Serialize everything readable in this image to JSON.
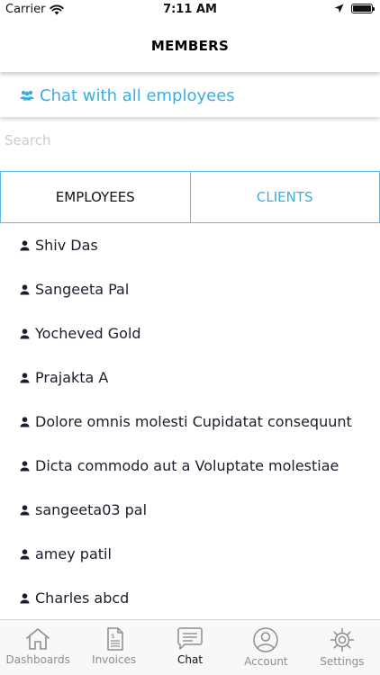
{
  "status_bar": {
    "carrier": "Carrier",
    "time": "7:11 AM"
  },
  "header": {
    "title": "MEMBERS"
  },
  "chat_all": {
    "label": "Chat with all employees",
    "icon": "group-icon",
    "color": "#3aaee0"
  },
  "search": {
    "placeholder": "Search",
    "value": ""
  },
  "tabs": [
    {
      "label": "EMPLOYEES",
      "selected": true
    },
    {
      "label": "CLIENTS",
      "selected": false
    }
  ],
  "members": [
    "Shiv Das",
    "Sangeeta Pal",
    "Yocheved Gold",
    "Prajakta A",
    "Dolore omnis molesti Cupidatat consequunt",
    "Dicta commodo aut a Voluptate molestiae",
    "sangeeta03 pal",
    "amey patil",
    "Charles abcd"
  ],
  "bottom_tabs": [
    {
      "label": "Dashboards",
      "icon": "home-icon",
      "active": false
    },
    {
      "label": "Invoices",
      "icon": "invoice-icon",
      "active": false
    },
    {
      "label": "Chat",
      "icon": "chat-icon",
      "active": true
    },
    {
      "label": "Account",
      "icon": "account-icon",
      "active": false
    },
    {
      "label": "Settings",
      "icon": "gear-icon",
      "active": false
    }
  ],
  "colors": {
    "accent": "#3aaee0",
    "tab_border": "#5bbde6",
    "inactive_tab": "#8e8e93"
  }
}
